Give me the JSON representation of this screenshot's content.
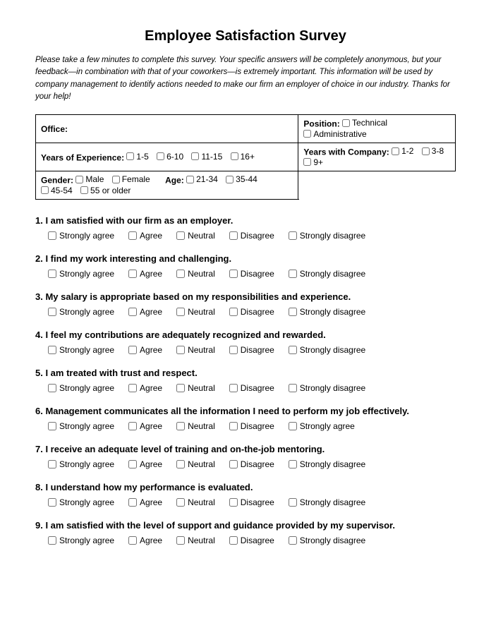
{
  "title": "Employee Satisfaction Survey",
  "intro": "Please take a few minutes to complete this survey. Your specific answers will be completely anonymous, but your feedback—in combination with that of your coworkers—is extremely important. This information will be used by company management to identify actions needed to make our firm an employer of choice in our industry. Thanks for your help!",
  "info": {
    "office_label": "Office:",
    "position_label": "Position:",
    "position_options": [
      "Technical",
      "Administrative"
    ],
    "years_exp_label": "Years of Experience:",
    "years_exp_options": [
      "1-5",
      "6-10",
      "11-15",
      "16+"
    ],
    "years_company_label": "Years with Company:",
    "years_company_options": [
      "1-2",
      "3-8",
      "9+"
    ],
    "gender_label": "Gender:",
    "gender_options": [
      "Male",
      "Female"
    ],
    "age_label": "Age:",
    "age_options": [
      "21-34",
      "35-44",
      "45-54",
      "55 or older"
    ]
  },
  "scale": [
    "Strongly agree",
    "Agree",
    "Neutral",
    "Disagree",
    "Strongly disagree"
  ],
  "scale_q6": [
    "Strongly agree",
    "Agree",
    "Neutral",
    "Disagree",
    "Strongly agree"
  ],
  "questions": [
    {
      "num": "1",
      "text": "I am satisfied with our firm as an employer."
    },
    {
      "num": "2",
      "text": "I find my work interesting and challenging."
    },
    {
      "num": "3",
      "text": "My salary is appropriate based on my responsibilities and experience."
    },
    {
      "num": "4",
      "text": "I feel my contributions are adequately recognized and rewarded."
    },
    {
      "num": "5",
      "text": "I am treated with trust and respect."
    },
    {
      "num": "6",
      "text": "Management communicates all the information I need to perform my job effectively."
    },
    {
      "num": "7",
      "text": " I receive an adequate level of training and on-the-job mentoring."
    },
    {
      "num": "8",
      "text": "I understand how my performance is evaluated."
    },
    {
      "num": "9",
      "text": "I am satisfied with the level of support and guidance provided by my supervisor."
    }
  ]
}
